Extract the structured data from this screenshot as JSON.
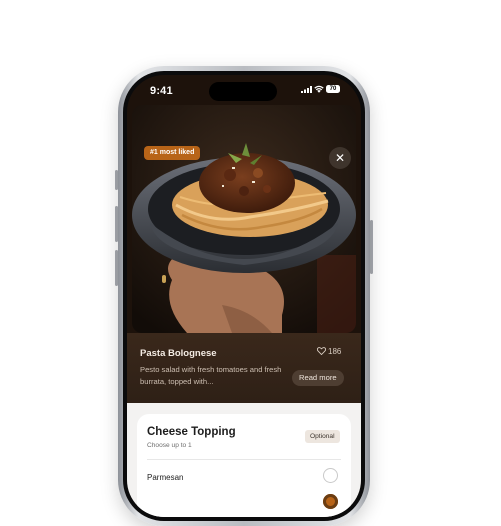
{
  "status_bar": {
    "time": "9:41",
    "battery": "70"
  },
  "hero": {
    "badge": "#1 most liked",
    "close_icon": "close-icon"
  },
  "dish": {
    "name": "Pasta Bolognese",
    "likes": "186",
    "description": "Pesto salad with fresh tomatoes and fresh burrata, topped with...",
    "read_more_label": "Read more"
  },
  "cheese_topping": {
    "title": "Cheese Topping",
    "subtitle": "Choose up to 1",
    "optional_label": "Optional",
    "options": [
      {
        "label": "Parmesan"
      }
    ]
  },
  "colors": {
    "accent": "#b86418",
    "panel": "#3a281b",
    "sheet": "#f3f2f1"
  }
}
